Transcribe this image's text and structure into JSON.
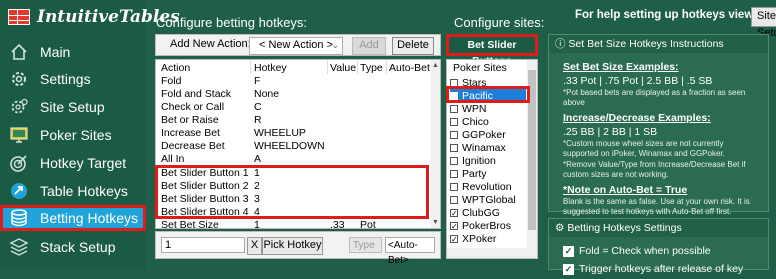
{
  "app": {
    "title": "IntuitiveTables"
  },
  "sidebar": {
    "items": [
      {
        "label": "Main",
        "icon": "home-icon"
      },
      {
        "label": "Settings",
        "icon": "gear-icon"
      },
      {
        "label": "Site Setup",
        "icon": "gears-icon"
      },
      {
        "label": "Poker Sites",
        "icon": "monitor-icon"
      },
      {
        "label": "Hotkey Target",
        "icon": "target-icon"
      },
      {
        "label": "Table Hotkeys",
        "icon": "arrow-circle-icon"
      },
      {
        "label": "Betting Hotkeys",
        "icon": "database-icon",
        "active": true
      },
      {
        "label": "Stack Setup",
        "icon": "layers-icon"
      }
    ]
  },
  "headers": {
    "betting": "Configure betting hotkeys:",
    "sites": "Configure sites:",
    "help": "For help setting up hotkeys view ->",
    "site_setup_button": "Site Setup"
  },
  "toolbar": {
    "add_new_label": "Add New Action:",
    "new_action_value": "< New Action >",
    "add_button": "Add",
    "delete_button": "Delete"
  },
  "table": {
    "columns": [
      "Action",
      "Hotkey",
      "Value",
      "Type",
      "Auto-Bet"
    ],
    "rows": [
      {
        "action": "Fold",
        "hotkey": "F",
        "value": "",
        "type": ""
      },
      {
        "action": "Fold and Stack",
        "hotkey": "None",
        "value": "",
        "type": ""
      },
      {
        "action": "Check or Call",
        "hotkey": "C",
        "value": "",
        "type": ""
      },
      {
        "action": "Bet or Raise",
        "hotkey": "R",
        "value": "",
        "type": ""
      },
      {
        "action": "Increase Bet",
        "hotkey": "WHEELUP",
        "value": "",
        "type": ""
      },
      {
        "action": "Decrease Bet",
        "hotkey": "WHEELDOWN",
        "value": "",
        "type": ""
      },
      {
        "action": "All In",
        "hotkey": "A",
        "value": "",
        "type": ""
      },
      {
        "action": "Bet Slider Button 1",
        "hotkey": "1",
        "value": "",
        "type": ""
      },
      {
        "action": "Bet Slider Button 2",
        "hotkey": "2",
        "value": "",
        "type": ""
      },
      {
        "action": "Bet Slider Button 3",
        "hotkey": "3",
        "value": "",
        "type": ""
      },
      {
        "action": "Bet Slider Button 4",
        "hotkey": "4",
        "value": "",
        "type": ""
      },
      {
        "action": "Set Bet Size",
        "hotkey": "1",
        "value": ".33",
        "type": "Pot"
      }
    ]
  },
  "edit": {
    "hotkey_value": "1",
    "clear_button": "X",
    "pick_button": "Pick Hotkey",
    "type_value": "Type",
    "autobet_value": "<Auto-Bet>"
  },
  "sites": {
    "title_button": "Bet Slider Buttons",
    "column": "Poker Sites",
    "items": [
      {
        "name": "Stars",
        "checked": false
      },
      {
        "name": "Pacific",
        "checked": false,
        "selected": true
      },
      {
        "name": "WPN",
        "checked": false
      },
      {
        "name": "Chico",
        "checked": false
      },
      {
        "name": "GGPoker",
        "checked": false
      },
      {
        "name": "Winamax",
        "checked": false
      },
      {
        "name": "Ignition",
        "checked": false
      },
      {
        "name": "Party",
        "checked": false
      },
      {
        "name": "Revolution",
        "checked": false
      },
      {
        "name": "WPTGlobal",
        "checked": false
      },
      {
        "name": "ClubGG",
        "checked": true
      },
      {
        "name": "PokerBros",
        "checked": true
      },
      {
        "name": "XPoker",
        "checked": true
      }
    ]
  },
  "instructions": {
    "title": "Set Bet Size Hotkeys Instructions",
    "examples_head": "Set Bet Size Examples:",
    "examples_line": ".33 Pot | .75 Pot | 2.5 BB | .5 SB",
    "examples_note": "*Pot based bets are displayed as a fraction as seen above",
    "incdec_head": "Increase/Decrease Examples:",
    "incdec_line": ".25 BB | 2 BB | 1 SB",
    "incdec_note1": "*Custom mouse wheel sizes are not currently supported on iPoker, Winamax and GGPoker.",
    "incdec_note2": "*Remove Value/Type from Increase/Decrease Bet if custom sizes are not working.",
    "autobet_head": "*Note on Auto-Bet = True",
    "autobet_note": "Blank is the same as false. Use at your own risk. It is suggested to test hotkeys with Auto-Bet off first."
  },
  "settings_panel": {
    "title": "Betting Hotkeys Settings",
    "fold_label": "Fold = Check when possible",
    "trigger_label": "Trigger hotkeys after release of key"
  }
}
